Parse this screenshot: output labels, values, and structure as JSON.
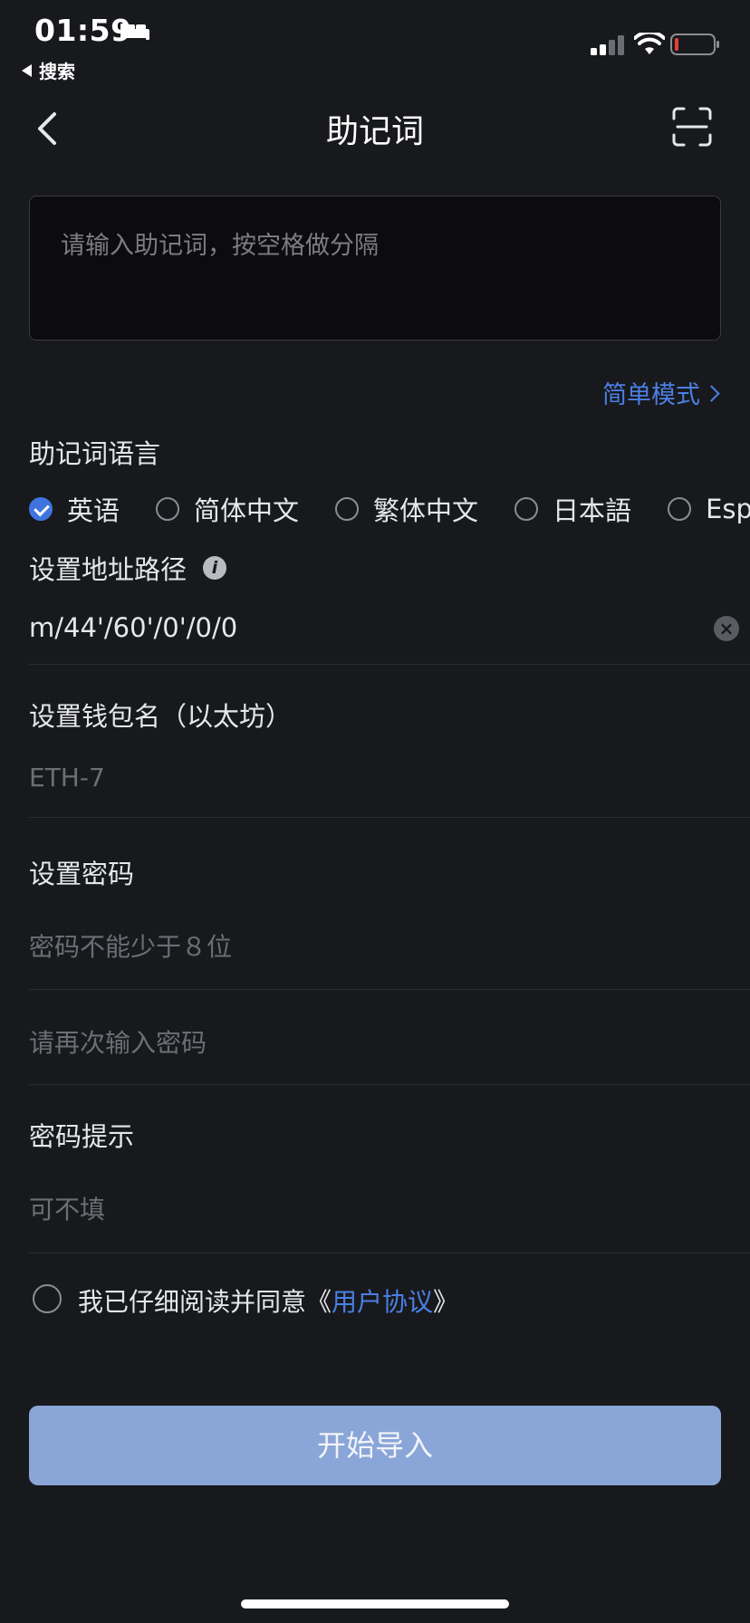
{
  "status_bar": {
    "time": "01:59",
    "back_app_label": "搜索"
  },
  "nav": {
    "title": "助记词"
  },
  "mnemonic": {
    "placeholder": "请输入助记词，按空格做分隔",
    "value": ""
  },
  "simple_mode_label": "简单模式",
  "language": {
    "label": "助记词语言",
    "options": [
      {
        "label": "英语",
        "selected": true
      },
      {
        "label": "简体中文",
        "selected": false
      },
      {
        "label": "繁体中文",
        "selected": false
      },
      {
        "label": "日本語",
        "selected": false
      },
      {
        "label": "Esp",
        "selected": false
      }
    ]
  },
  "path": {
    "label": "设置地址路径",
    "info_icon_text": "i",
    "value": "m/44'/60'/0'/0/0"
  },
  "wallet_name": {
    "label": "设置钱包名（以太坊）",
    "placeholder": "ETH-7"
  },
  "password": {
    "label": "设置密码",
    "placeholder": "密码不能少于８位",
    "confirm_placeholder": "请再次输入密码"
  },
  "hint": {
    "label": "密码提示",
    "placeholder": "可不填"
  },
  "agreement": {
    "text": "我已仔细阅读并同意《",
    "link": "用户协议",
    "suffix": "》",
    "checked": false
  },
  "submit_label": "开始导入",
  "colors": {
    "background": "#18191d",
    "accent": "#4b7fe3",
    "button_disabled": "#8aa6d8"
  }
}
